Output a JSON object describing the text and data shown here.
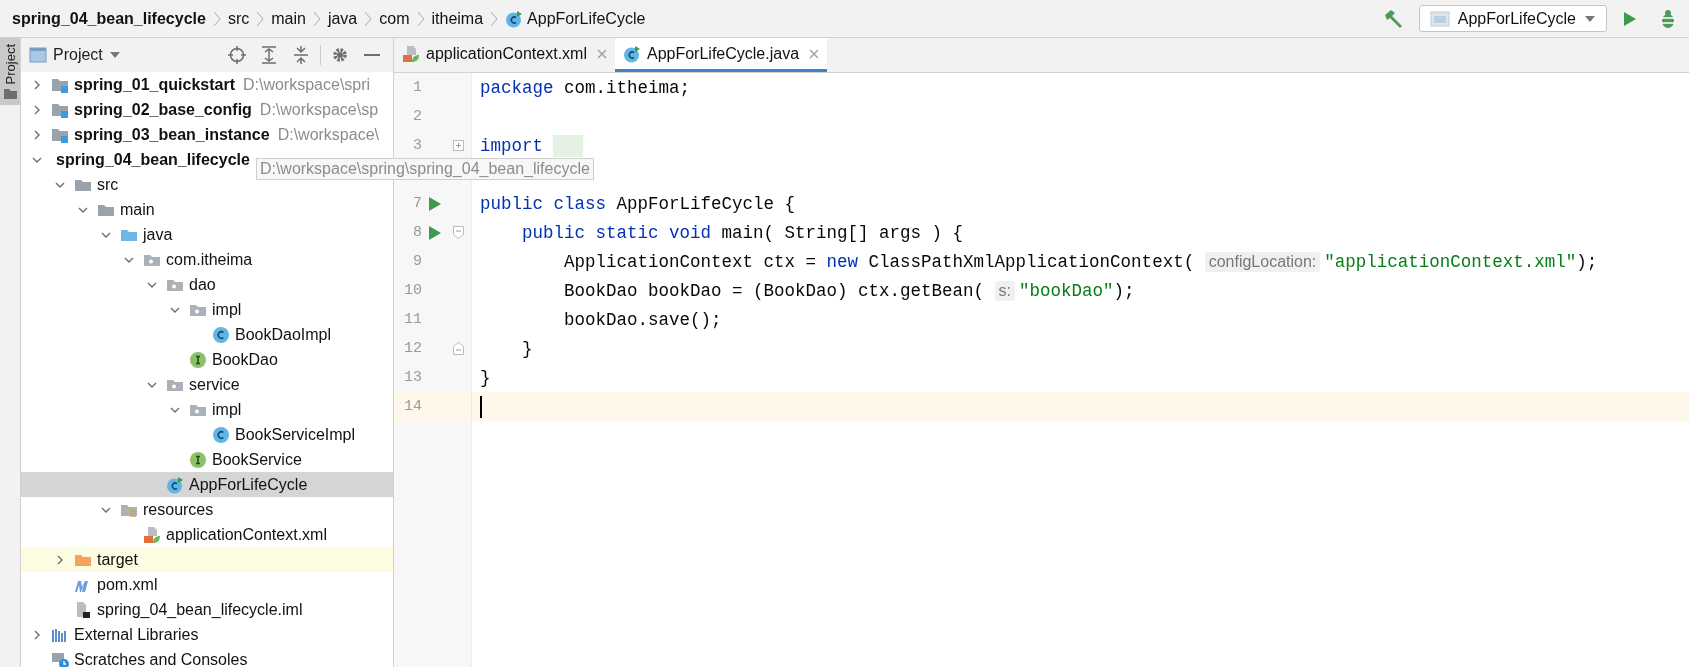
{
  "breadcrumbs": [
    {
      "label": "spring_04_bean_lifecycle",
      "kind": "module"
    },
    {
      "label": "src",
      "kind": "folder"
    },
    {
      "label": "main",
      "kind": "folder"
    },
    {
      "label": "java",
      "kind": "folder"
    },
    {
      "label": "com",
      "kind": "folder"
    },
    {
      "label": "itheima",
      "kind": "folder"
    },
    {
      "label": "AppForLifeCycle",
      "kind": "main-class"
    }
  ],
  "run_configuration": {
    "label": "AppForLifeCycle"
  },
  "side_stripe": {
    "label": "Project"
  },
  "project_panel": {
    "title": "Project",
    "tree": [
      {
        "label": "spring_01_quickstart",
        "kind": "module",
        "path": "D:\\workspace\\spri",
        "expanded": false,
        "selected": false,
        "hovered": false
      },
      {
        "label": "spring_02_base_config",
        "kind": "module",
        "path": "D:\\workspace\\sp",
        "expanded": false,
        "selected": false,
        "hovered": false
      },
      {
        "label": "spring_03_bean_instance",
        "kind": "module",
        "path": "D:\\workspace\\",
        "expanded": false,
        "selected": false,
        "hovered": false
      },
      {
        "label": "spring_04_bean_lifecycle",
        "kind": "module",
        "path": "D:\\workspace\\spring\\spring_04_bean_lifecycle",
        "expanded": true,
        "selected": false,
        "hovered": true,
        "children": [
          {
            "label": "src",
            "kind": "folder",
            "expanded": true,
            "selected": false,
            "children": [
              {
                "label": "main",
                "kind": "folder",
                "expanded": true,
                "selected": false,
                "children": [
                  {
                    "label": "java",
                    "kind": "source-folder",
                    "expanded": true,
                    "selected": false,
                    "children": [
                      {
                        "label": "com.itheima",
                        "kind": "package",
                        "expanded": true,
                        "selected": false,
                        "children": [
                          {
                            "label": "dao",
                            "kind": "package",
                            "expanded": true,
                            "selected": false,
                            "children": [
                              {
                                "label": "impl",
                                "kind": "package",
                                "expanded": true,
                                "selected": false,
                                "children": [
                                  {
                                    "label": "BookDaoImpl",
                                    "kind": "class",
                                    "selected": false
                                  }
                                ]
                              },
                              {
                                "label": "BookDao",
                                "kind": "interface",
                                "selected": false
                              }
                            ]
                          },
                          {
                            "label": "service",
                            "kind": "package",
                            "expanded": true,
                            "selected": false,
                            "children": [
                              {
                                "label": "impl",
                                "kind": "package",
                                "expanded": true,
                                "selected": false,
                                "children": [
                                  {
                                    "label": "BookServiceImpl",
                                    "kind": "class",
                                    "selected": false
                                  }
                                ]
                              },
                              {
                                "label": "BookService",
                                "kind": "interface",
                                "selected": false
                              }
                            ]
                          },
                          {
                            "label": "AppForLifeCycle",
                            "kind": "main-class",
                            "selected": true
                          }
                        ]
                      }
                    ]
                  },
                  {
                    "label": "resources",
                    "kind": "resources-folder",
                    "expanded": true,
                    "selected": false,
                    "children": [
                      {
                        "label": "applicationContext.xml",
                        "kind": "xml",
                        "selected": false
                      }
                    ]
                  }
                ]
              }
            ]
          },
          {
            "label": "target",
            "kind": "excluded-folder",
            "expanded": false,
            "selected": false
          },
          {
            "label": "pom.xml",
            "kind": "maven",
            "selected": false
          },
          {
            "label": "spring_04_bean_lifecycle.iml",
            "kind": "iml",
            "selected": false
          }
        ]
      },
      {
        "label": "External Libraries",
        "kind": "libraries",
        "expanded": false,
        "selected": false
      },
      {
        "label": "Scratches and Consoles",
        "kind": "scratches",
        "selected": false
      }
    ]
  },
  "tabs": [
    {
      "label": "applicationContext.xml",
      "kind": "xml",
      "selected": false
    },
    {
      "label": "AppForLifeCycle.java",
      "kind": "main-class",
      "selected": true
    }
  ],
  "editor": {
    "lines": [
      {
        "number": "1",
        "tokens": [
          {
            "kind": "keyword",
            "text": "package"
          },
          {
            "kind": "plain",
            "text": " com.itheima;"
          }
        ]
      },
      {
        "number": "2"
      },
      {
        "number": "3",
        "fold": {
          "kind": "collapsed"
        },
        "tokens": [
          {
            "kind": "keyword",
            "text": "import"
          },
          {
            "kind": "folded"
          }
        ]
      },
      {
        "number": "7",
        "run": true,
        "tokens": [
          {
            "kind": "keyword",
            "text": "public class"
          },
          {
            "kind": "plain",
            "text": " AppForLifeCycle {"
          }
        ]
      },
      {
        "number": "8",
        "run": true,
        "fold": {
          "kind": "open"
        },
        "tokens": [
          {
            "kind": "keyword",
            "text": "    public static void"
          },
          {
            "kind": "plain",
            "text": " main( String[] args ) {"
          }
        ]
      },
      {
        "number": "9",
        "tokens": [
          {
            "kind": "plain",
            "text": "        ApplicationContext ctx = "
          },
          {
            "kind": "keyword",
            "text": "new"
          },
          {
            "kind": "plain",
            "text": " ClassPathXmlApplicationContext( "
          },
          {
            "kind": "hint",
            "text": "configLocation:"
          },
          {
            "kind": "string",
            "text": "\"applicationContext.xml\""
          },
          {
            "kind": "plain",
            "text": ");"
          }
        ]
      },
      {
        "number": "10",
        "tokens": [
          {
            "kind": "plain",
            "text": "        BookDao bookDao = (BookDao) ctx.getBean( "
          },
          {
            "kind": "hint",
            "text": "s:"
          },
          {
            "kind": "string",
            "text": "\"bookDao\""
          },
          {
            "kind": "plain",
            "text": ");"
          }
        ]
      },
      {
        "number": "11",
        "tokens": [
          {
            "kind": "plain",
            "text": "        bookDao.save();"
          }
        ]
      },
      {
        "number": "12",
        "fold": {
          "kind": "close"
        },
        "tokens": [
          {
            "kind": "plain",
            "text": "    }"
          }
        ]
      },
      {
        "number": "13",
        "tokens": [
          {
            "kind": "plain",
            "text": "}"
          }
        ]
      },
      {
        "number": "14",
        "current": true
      }
    ]
  }
}
